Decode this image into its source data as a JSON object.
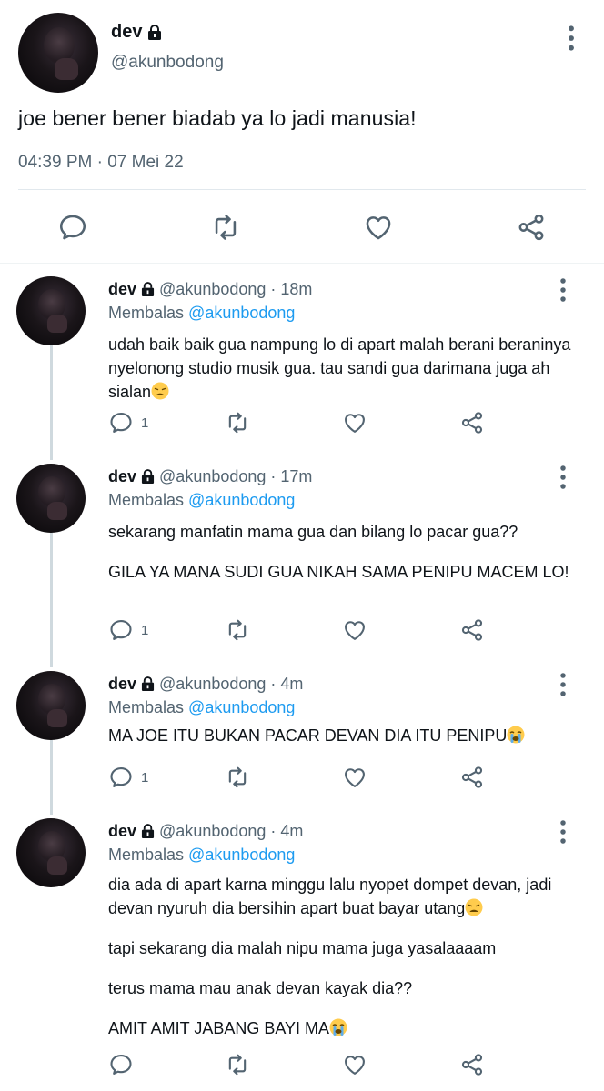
{
  "main_tweet": {
    "name": "dev",
    "handle": "@akunbodong",
    "text": "joe bener bener biadab ya lo jadi manusia!",
    "timestamp": "04:39 PM · 07 Mei 22",
    "icons": [
      "reply-icon",
      "retweet-icon",
      "like-icon",
      "share-icon"
    ]
  },
  "replies": [
    {
      "name": "dev",
      "handle": "@akunbodong",
      "time": "18m",
      "replying_prefix": "Membalas",
      "replying_to": "@akunbodong",
      "text": [
        "udah baik baik gua nampung lo di apart malah berani beraninya nyelonong studio musik gua. tau sandi gua darimana juga ah sialan"
      ],
      "emojis": [
        "weary-face"
      ],
      "reply_count": "1"
    },
    {
      "name": "dev",
      "handle": "@akunbodong",
      "time": "17m",
      "replying_prefix": "Membalas",
      "replying_to": "@akunbodong",
      "text": [
        "sekarang manfatin mama gua dan bilang lo pacar gua??",
        "GILA YA MANA SUDI GUA NIKAH SAMA PENIPU MACEM LO!"
      ],
      "reply_count": "1"
    },
    {
      "name": "dev",
      "handle": "@akunbodong",
      "time": "4m",
      "replying_prefix": "Membalas",
      "replying_to": "@akunbodong",
      "text": [
        "MA JOE ITU BUKAN PACAR DEVAN DIA ITU PENIPU"
      ],
      "emojis": [
        "crying-face"
      ],
      "reply_count": "1"
    },
    {
      "name": "dev",
      "handle": "@akunbodong",
      "time": "4m",
      "replying_prefix": "Membalas",
      "replying_to": "@akunbodong",
      "text": [
        "dia ada di apart karna minggu lalu nyopet dompet devan, jadi devan nyuruh dia bersihin apart buat bayar utang",
        "tapi sekarang dia malah nipu mama juga yasalaaaam",
        "terus mama mau anak devan kayak dia??",
        "AMIT AMIT JABANG BAYI MA"
      ],
      "emojis": [
        "weary-face",
        "crying-face"
      ],
      "reply_count": ""
    }
  ],
  "colors": {
    "text": "#0f1419",
    "secondary": "#536471",
    "mention": "#1d9bf0",
    "thread_line": "#cfd9de"
  }
}
